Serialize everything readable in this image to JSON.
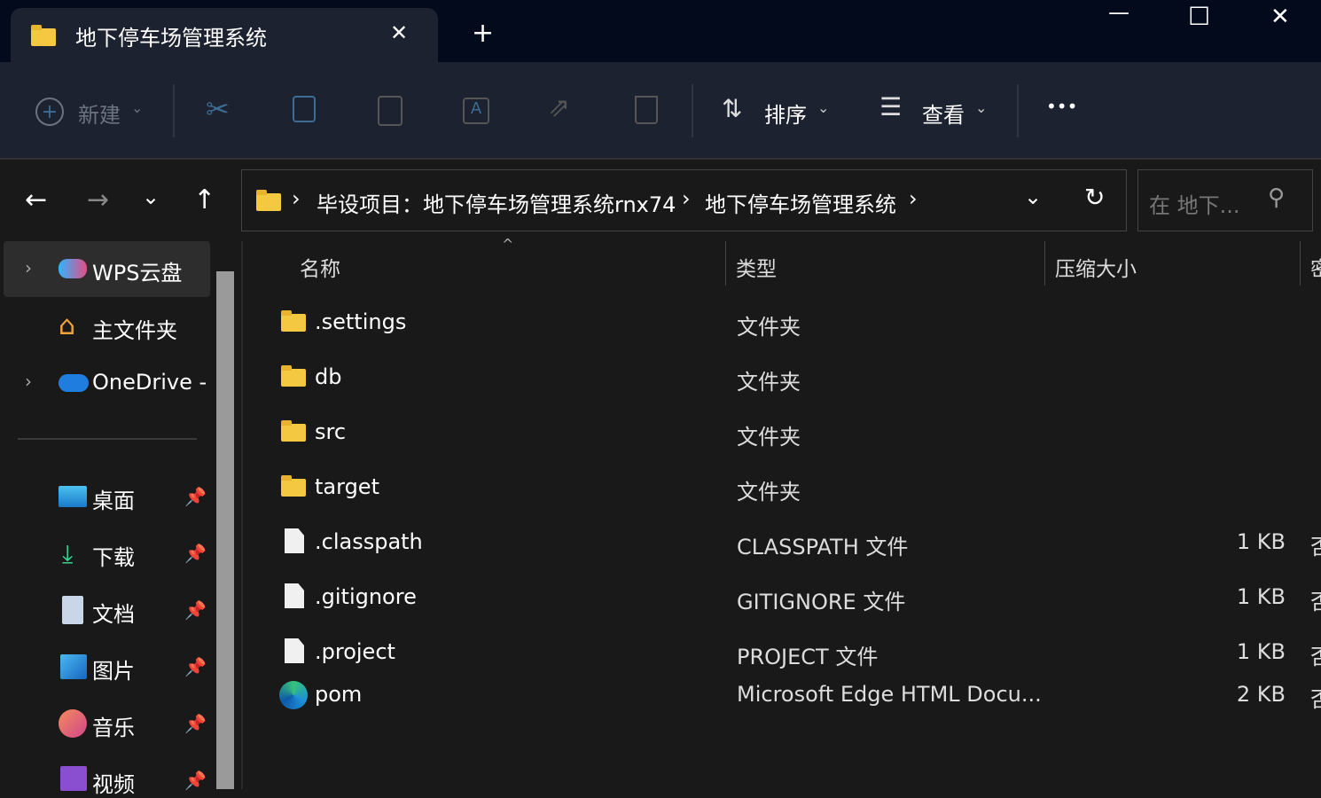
{
  "window": {
    "tab_title": "地下停车场管理系统",
    "new_tab": "+",
    "close_tab": "✕",
    "minimize": "—",
    "maximize": "☐",
    "close": "✕"
  },
  "toolbar": {
    "new_label": "新建",
    "sort_label": "排序",
    "view_label": "查看",
    "more": "•••"
  },
  "address": {
    "crumbs": [
      "毕设项目：地下停车场管理系统rnx74",
      "地下停车场管理系统"
    ],
    "sep": "›",
    "search_placeholder": "在 地下..."
  },
  "sidebar": {
    "items": [
      {
        "label": "WPS云盘"
      },
      {
        "label": "主文件夹"
      },
      {
        "label": "OneDrive -"
      }
    ],
    "quick": [
      {
        "label": "桌面"
      },
      {
        "label": "下载"
      },
      {
        "label": "文档"
      },
      {
        "label": "图片"
      },
      {
        "label": "音乐"
      },
      {
        "label": "视频"
      }
    ]
  },
  "columns": {
    "name": "名称",
    "type": "类型",
    "size": "压缩大小",
    "next": "密"
  },
  "files": [
    {
      "name": ".settings",
      "type": "文件夹",
      "size": "",
      "extra": "",
      "kind": "folder"
    },
    {
      "name": "db",
      "type": "文件夹",
      "size": "",
      "extra": "",
      "kind": "folder"
    },
    {
      "name": "src",
      "type": "文件夹",
      "size": "",
      "extra": "",
      "kind": "folder"
    },
    {
      "name": "target",
      "type": "文件夹",
      "size": "",
      "extra": "",
      "kind": "folder"
    },
    {
      "name": ".classpath",
      "type": "CLASSPATH 文件",
      "size": "1 KB",
      "extra": "否",
      "kind": "file"
    },
    {
      "name": ".gitignore",
      "type": "GITIGNORE 文件",
      "size": "1 KB",
      "extra": "否",
      "kind": "file"
    },
    {
      "name": ".project",
      "type": "PROJECT 文件",
      "size": "1 KB",
      "extra": "否",
      "kind": "file"
    },
    {
      "name": "pom",
      "type": "Microsoft Edge HTML Docu...",
      "size": "2 KB",
      "extra": "否",
      "kind": "edge"
    }
  ]
}
